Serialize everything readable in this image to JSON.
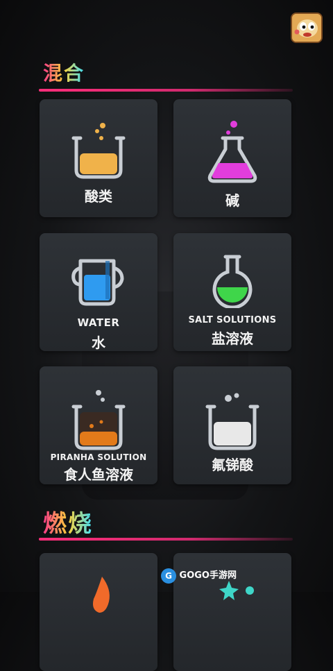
{
  "sections": {
    "mix": {
      "title": "混合"
    },
    "burn": {
      "title": "燃烧"
    }
  },
  "cards": [
    {
      "name": "acid",
      "cn": "酸类",
      "en": ""
    },
    {
      "name": "base",
      "cn": "碱",
      "en": ""
    },
    {
      "name": "water",
      "cn": "水",
      "en": "WATER"
    },
    {
      "name": "salt",
      "cn": "盐溶液",
      "en": "SALT SOLUTIONS"
    },
    {
      "name": "piranha",
      "cn": "食人鱼溶液",
      "en": "PIRANHA SOLUTION"
    },
    {
      "name": "hf",
      "cn": "氟锑酸",
      "en": ""
    }
  ],
  "icons": {
    "acid": "beaker-icon",
    "base": "flask-icon",
    "water": "pitcher-icon",
    "salt": "round-flask-icon",
    "piranha": "beaker-icon",
    "hf": "beaker-icon"
  },
  "colors": {
    "acid": "#f0b24a",
    "base": "#e23ddc",
    "water": "#2f9bf0",
    "salt": "#3fd64a",
    "piranha": "#e27a1a",
    "hf": "#e8e8e8"
  },
  "watermark": {
    "text": "GOGO手游网"
  }
}
